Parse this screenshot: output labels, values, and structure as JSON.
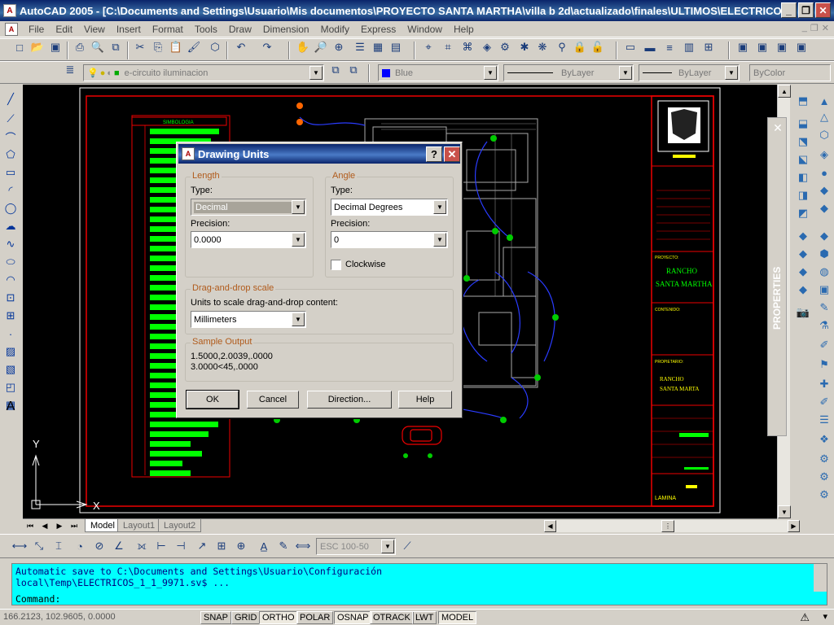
{
  "window": {
    "title": "AutoCAD 2005 - [C:\\Documents and Settings\\Usuario\\Mis documentos\\PROYECTO SANTA MARTHA\\villa b 2d\\actualizado\\finales\\ULTIMOS\\ELECTRICO..."
  },
  "menu": [
    "File",
    "Edit",
    "View",
    "Insert",
    "Format",
    "Tools",
    "Draw",
    "Dimension",
    "Modify",
    "Express",
    "Window",
    "Help"
  ],
  "layers": {
    "current_layer": "e-circuito iluminacion",
    "color": "Blue",
    "linetype": "ByLayer",
    "lineweight": "ByLayer",
    "plotstyle": "ByColor"
  },
  "dim_style": "ESC 100-50",
  "canvas": {
    "ucs_x": "X",
    "ucs_y": "Y",
    "legend_title": "SIMBOLOGIA",
    "titleblock": {
      "proyecto_label": "PROYECTO:",
      "proyecto_value_1": "RANCHO",
      "proyecto_value_2": "SANTA MARTHA",
      "contenido_label": "CONTENIDO:",
      "propietario_label": "PROPIETARIO:",
      "propietario_value_1": "RANCHO",
      "propietario_value_2": "SANTA MARTA",
      "lamina_label": "LAMINA"
    }
  },
  "tabs": [
    "Model",
    "Layout1",
    "Layout2"
  ],
  "active_tab": "Model",
  "palette": {
    "title": "PROPERTIES"
  },
  "command": {
    "line1": "Automatic save to C:\\Documents and Settings\\Usuario\\Configuración",
    "line2": "local\\Temp\\ELECTRICOS_1_1_9971.sv$ ...",
    "prompt": "Command:"
  },
  "status": {
    "coords": "166.2123, 102.9605, 0.0000",
    "buttons": [
      {
        "label": "SNAP",
        "on": false
      },
      {
        "label": "GRID",
        "on": false
      },
      {
        "label": "ORTHO",
        "on": true
      },
      {
        "label": "POLAR",
        "on": false
      },
      {
        "label": "OSNAP",
        "on": true
      },
      {
        "label": "OTRACK",
        "on": false
      },
      {
        "label": "LWT",
        "on": false
      },
      {
        "label": "MODEL",
        "on": true
      }
    ]
  },
  "dialog": {
    "title": "Drawing Units",
    "length": {
      "group": "Length",
      "type_label": "Type:",
      "type_value": "Decimal",
      "precision_label": "Precision:",
      "precision_value": "0.0000"
    },
    "angle": {
      "group": "Angle",
      "type_label": "Type:",
      "type_value": "Decimal Degrees",
      "precision_label": "Precision:",
      "precision_value": "0",
      "clockwise_label": "Clockwise",
      "clockwise": false
    },
    "dragdrop": {
      "group": "Drag-and-drop scale",
      "label": "Units to scale drag-and-drop content:",
      "value": "Millimeters"
    },
    "sample": {
      "group": "Sample Output",
      "line1": "1.5000,2.0039,.0000",
      "line2": "3.0000<45,.0000"
    },
    "buttons": {
      "ok": "OK",
      "cancel": "Cancel",
      "direction": "Direction...",
      "help": "Help"
    }
  }
}
